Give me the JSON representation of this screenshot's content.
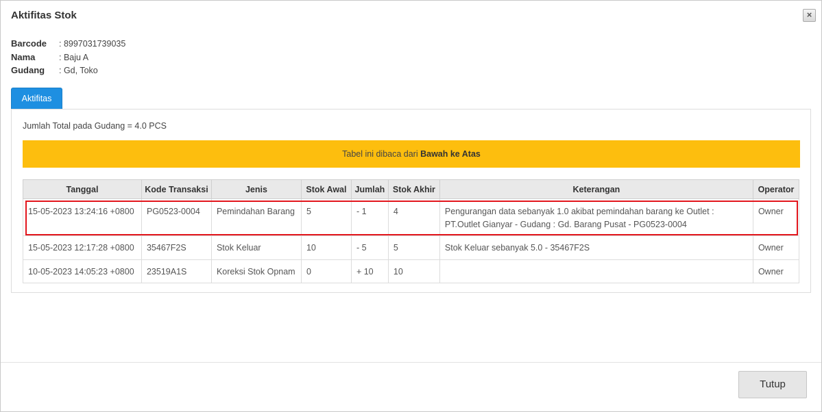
{
  "modal": {
    "title": "Aktifitas Stok",
    "close_label": "×",
    "tutup_label": "Tutup"
  },
  "info": {
    "barcode_key": "Barcode",
    "barcode_val": ": 8997031739035",
    "nama_key": "Nama",
    "nama_val": ": Baju A",
    "gudang_key": "Gudang",
    "gudang_val": ": Gd, Toko"
  },
  "tab": {
    "label": "Aktifitas"
  },
  "panel": {
    "total_text": "Jumlah Total pada Gudang = 4.0 PCS",
    "alert_prefix": "Tabel ini dibaca dari ",
    "alert_bold": "Bawah ke Atas"
  },
  "table": {
    "headers": [
      "Tanggal",
      "Kode Transaksi",
      "Jenis",
      "Stok Awal",
      "Jumlah",
      "Stok Akhir",
      "Keterangan",
      "Operator"
    ],
    "rows": [
      [
        "15-05-2023 13:24:16 +0800",
        "PG0523-0004",
        "Pemindahan Barang",
        "5",
        "- 1",
        "4",
        "Pengurangan data sebanyak 1.0 akibat pemindahan barang ke Outlet : PT.Outlet Gianyar - Gudang : Gd. Barang Pusat - PG0523-0004",
        "Owner"
      ],
      [
        "15-05-2023 12:17:28 +0800",
        "35467F2S",
        "Stok Keluar",
        "10",
        "- 5",
        "5",
        "Stok Keluar sebanyak 5.0 - 35467F2S",
        "Owner"
      ],
      [
        "10-05-2023 14:05:23 +0800",
        "23519A1S",
        "Koreksi Stok Opnam",
        "0",
        "+ 10",
        "10",
        "",
        "Owner"
      ]
    ]
  },
  "colors": {
    "tab_blue": "#1e8fe1",
    "alert_yellow": "#fdbe0e",
    "highlight_red": "#e2141b"
  }
}
